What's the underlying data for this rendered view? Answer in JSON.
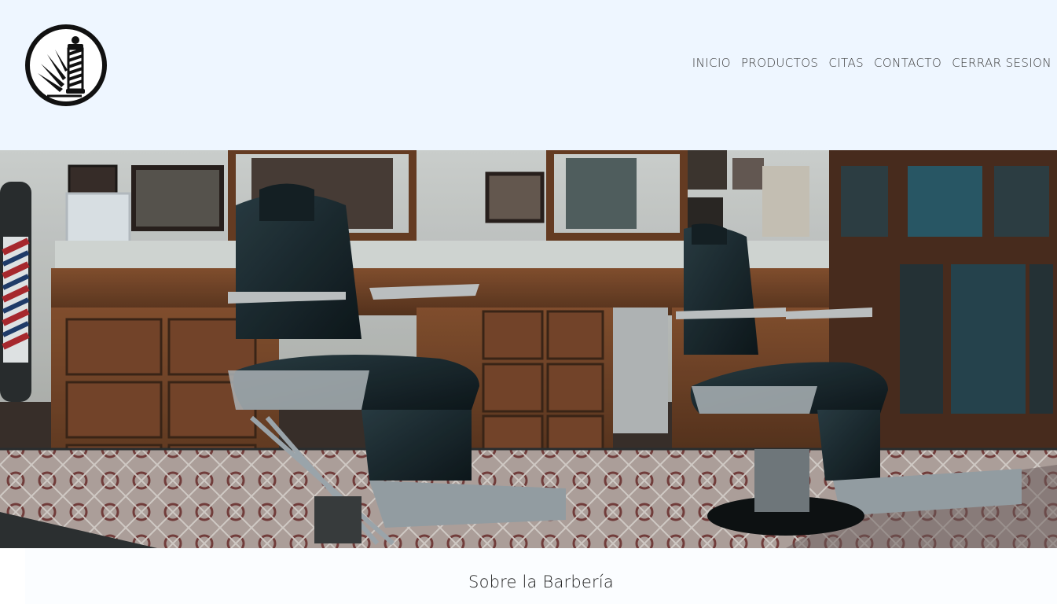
{
  "nav": {
    "items": [
      {
        "label": "INICIO"
      },
      {
        "label": "PRODUCTOS"
      },
      {
        "label": "CITAS"
      },
      {
        "label": "CONTACTO"
      },
      {
        "label": "CERRAR SESION"
      }
    ]
  },
  "logo": {
    "icon": "barber-pole-razor-icon"
  },
  "hero": {
    "icon": "barbershop-interior-photo"
  },
  "about": {
    "title": "Sobre la Barbería"
  },
  "colors": {
    "header_bg": "#eef6ff",
    "nav_text": "#3a3a3a",
    "logo": "#111111"
  }
}
